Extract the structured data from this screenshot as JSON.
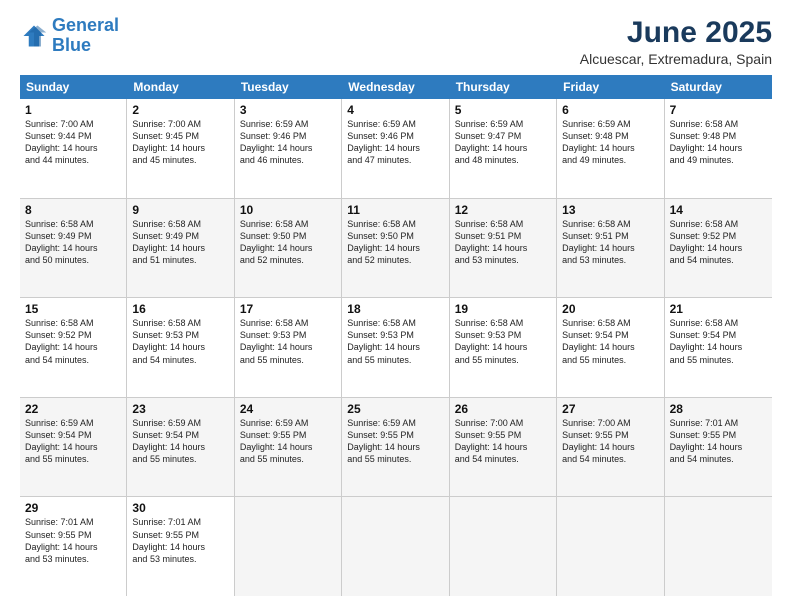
{
  "logo": {
    "line1": "General",
    "line2": "Blue"
  },
  "title": "June 2025",
  "subtitle": "Alcuescar, Extremadura, Spain",
  "days": [
    "Sunday",
    "Monday",
    "Tuesday",
    "Wednesday",
    "Thursday",
    "Friday",
    "Saturday"
  ],
  "weeks": [
    [
      {
        "day": "1",
        "sunrise": "7:00 AM",
        "sunset": "9:44 PM",
        "daylight": "14 hours and 44 minutes."
      },
      {
        "day": "2",
        "sunrise": "7:00 AM",
        "sunset": "9:45 PM",
        "daylight": "14 hours and 45 minutes."
      },
      {
        "day": "3",
        "sunrise": "6:59 AM",
        "sunset": "9:46 PM",
        "daylight": "14 hours and 46 minutes."
      },
      {
        "day": "4",
        "sunrise": "6:59 AM",
        "sunset": "9:46 PM",
        "daylight": "14 hours and 47 minutes."
      },
      {
        "day": "5",
        "sunrise": "6:59 AM",
        "sunset": "9:47 PM",
        "daylight": "14 hours and 48 minutes."
      },
      {
        "day": "6",
        "sunrise": "6:59 AM",
        "sunset": "9:48 PM",
        "daylight": "14 hours and 49 minutes."
      },
      {
        "day": "7",
        "sunrise": "6:58 AM",
        "sunset": "9:48 PM",
        "daylight": "14 hours and 49 minutes."
      }
    ],
    [
      {
        "day": "8",
        "sunrise": "6:58 AM",
        "sunset": "9:49 PM",
        "daylight": "14 hours and 50 minutes."
      },
      {
        "day": "9",
        "sunrise": "6:58 AM",
        "sunset": "9:49 PM",
        "daylight": "14 hours and 51 minutes."
      },
      {
        "day": "10",
        "sunrise": "6:58 AM",
        "sunset": "9:50 PM",
        "daylight": "14 hours and 52 minutes."
      },
      {
        "day": "11",
        "sunrise": "6:58 AM",
        "sunset": "9:50 PM",
        "daylight": "14 hours and 52 minutes."
      },
      {
        "day": "12",
        "sunrise": "6:58 AM",
        "sunset": "9:51 PM",
        "daylight": "14 hours and 53 minutes."
      },
      {
        "day": "13",
        "sunrise": "6:58 AM",
        "sunset": "9:51 PM",
        "daylight": "14 hours and 53 minutes."
      },
      {
        "day": "14",
        "sunrise": "6:58 AM",
        "sunset": "9:52 PM",
        "daylight": "14 hours and 54 minutes."
      }
    ],
    [
      {
        "day": "15",
        "sunrise": "6:58 AM",
        "sunset": "9:52 PM",
        "daylight": "14 hours and 54 minutes."
      },
      {
        "day": "16",
        "sunrise": "6:58 AM",
        "sunset": "9:53 PM",
        "daylight": "14 hours and 54 minutes."
      },
      {
        "day": "17",
        "sunrise": "6:58 AM",
        "sunset": "9:53 PM",
        "daylight": "14 hours and 55 minutes."
      },
      {
        "day": "18",
        "sunrise": "6:58 AM",
        "sunset": "9:53 PM",
        "daylight": "14 hours and 55 minutes."
      },
      {
        "day": "19",
        "sunrise": "6:58 AM",
        "sunset": "9:53 PM",
        "daylight": "14 hours and 55 minutes."
      },
      {
        "day": "20",
        "sunrise": "6:58 AM",
        "sunset": "9:54 PM",
        "daylight": "14 hours and 55 minutes."
      },
      {
        "day": "21",
        "sunrise": "6:58 AM",
        "sunset": "9:54 PM",
        "daylight": "14 hours and 55 minutes."
      }
    ],
    [
      {
        "day": "22",
        "sunrise": "6:59 AM",
        "sunset": "9:54 PM",
        "daylight": "14 hours and 55 minutes."
      },
      {
        "day": "23",
        "sunrise": "6:59 AM",
        "sunset": "9:54 PM",
        "daylight": "14 hours and 55 minutes."
      },
      {
        "day": "24",
        "sunrise": "6:59 AM",
        "sunset": "9:55 PM",
        "daylight": "14 hours and 55 minutes."
      },
      {
        "day": "25",
        "sunrise": "6:59 AM",
        "sunset": "9:55 PM",
        "daylight": "14 hours and 55 minutes."
      },
      {
        "day": "26",
        "sunrise": "7:00 AM",
        "sunset": "9:55 PM",
        "daylight": "14 hours and 54 minutes."
      },
      {
        "day": "27",
        "sunrise": "7:00 AM",
        "sunset": "9:55 PM",
        "daylight": "14 hours and 54 minutes."
      },
      {
        "day": "28",
        "sunrise": "7:01 AM",
        "sunset": "9:55 PM",
        "daylight": "14 hours and 54 minutes."
      }
    ],
    [
      {
        "day": "29",
        "sunrise": "7:01 AM",
        "sunset": "9:55 PM",
        "daylight": "14 hours and 53 minutes."
      },
      {
        "day": "30",
        "sunrise": "7:01 AM",
        "sunset": "9:55 PM",
        "daylight": "14 hours and 53 minutes."
      },
      null,
      null,
      null,
      null,
      null
    ]
  ]
}
